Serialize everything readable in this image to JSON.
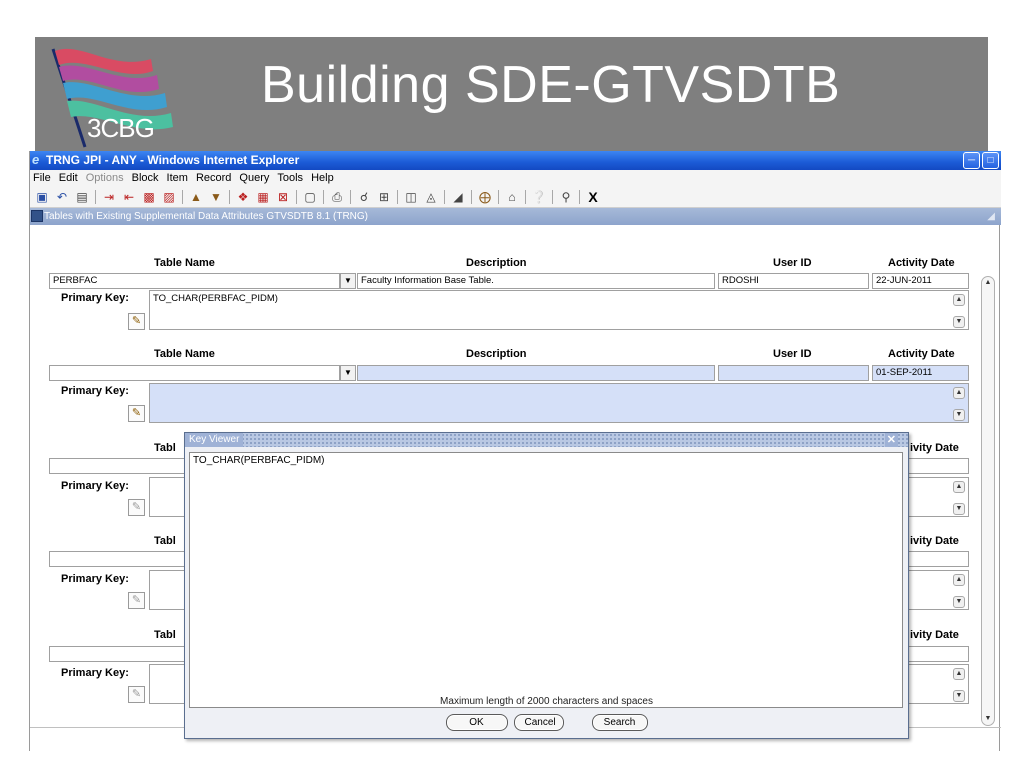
{
  "slide": {
    "title": "Building SDE-GTVSDTB",
    "logo_text": "3CBG"
  },
  "window": {
    "title": "TRNG JPI - ANY - Windows Internet Explorer",
    "menu": [
      "File",
      "Edit",
      "Options",
      "Block",
      "Item",
      "Record",
      "Query",
      "Tools",
      "Help"
    ],
    "toolbar_close": "X",
    "form_title": "Tables with Existing Supplemental Data Attributes  GTVSDTB  8.1  (TRNG)"
  },
  "headers": {
    "table_name": "Table Name",
    "description": "Description",
    "user_id": "User ID",
    "activity_date": "Activity Date",
    "primary_key": "Primary Key:",
    "table_name_partial": "Tabl",
    "activity_date_partial": "ivity Date"
  },
  "records": [
    {
      "table_name": "PERBFAC",
      "description": "Faculty Information Base Table.",
      "user_id": "RDOSHI",
      "activity_date": "22-JUN-2011",
      "primary_key": "TO_CHAR(PERBFAC_PIDM)"
    },
    {
      "table_name": "",
      "description": "",
      "user_id": "",
      "activity_date": "01-SEP-2011",
      "primary_key": ""
    }
  ],
  "dialog": {
    "title": "Key Viewer",
    "content": "TO_CHAR(PERBFAC_PIDM)",
    "message": "Maximum length of 2000 characters and spaces",
    "ok_label": "OK",
    "cancel_label": "Cancel",
    "search_label": "Search"
  }
}
